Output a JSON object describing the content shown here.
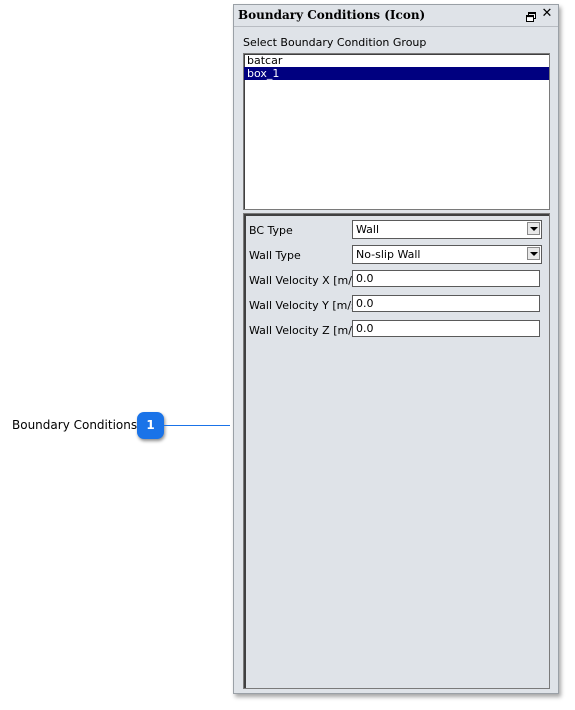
{
  "panel": {
    "title": "Boundary Conditions (Icon)",
    "group_label": "Select Boundary Condition Group",
    "groups": [
      {
        "label": "batcar"
      },
      {
        "label": "box_1",
        "selected": true
      }
    ],
    "properties": {
      "bc_type": {
        "label": "BC Type",
        "value": "Wall"
      },
      "wall_type": {
        "label": "Wall Type",
        "value": "No-slip Wall"
      },
      "wall_velocity_x": {
        "label": "Wall Velocity X [m/s]",
        "value": "0.0"
      },
      "wall_velocity_y": {
        "label": "Wall Velocity Y [m/s]",
        "value": "0.0"
      },
      "wall_velocity_z": {
        "label": "Wall Velocity Z [m/s]",
        "value": "0.0"
      }
    }
  },
  "callout": {
    "label": "Boundary Conditions",
    "number": "1",
    "color": "#1a73e8"
  },
  "colors": {
    "selection": "#000080",
    "panel_bg": "#dfe3e8"
  }
}
